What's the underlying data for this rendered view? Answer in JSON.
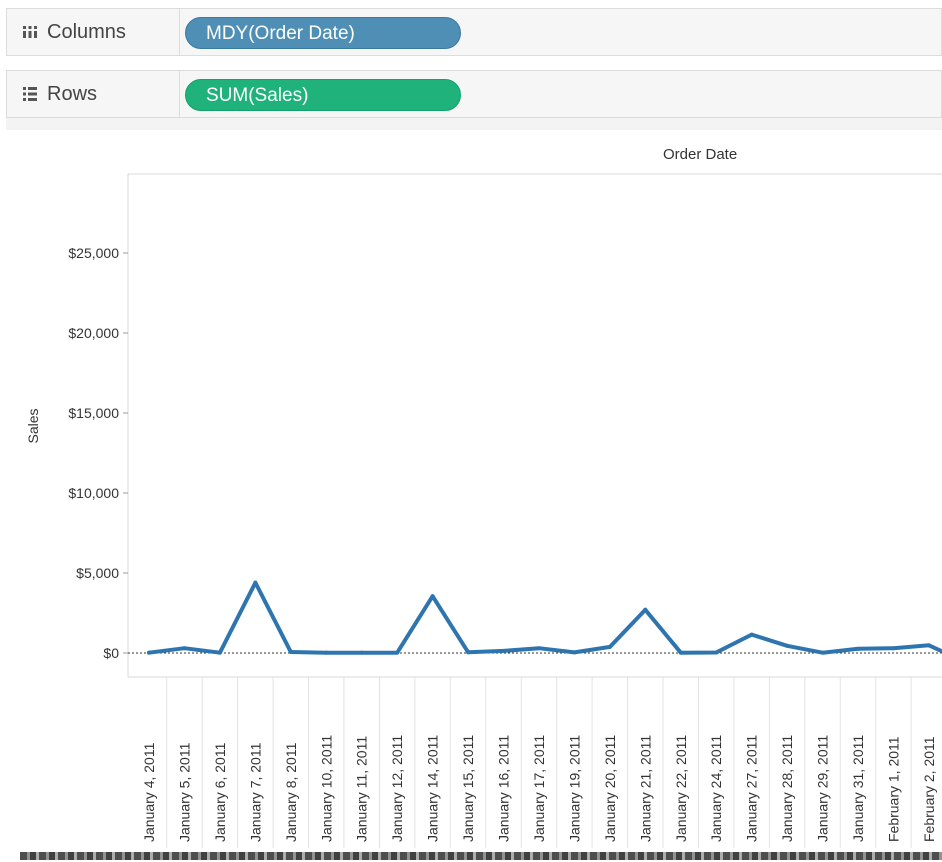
{
  "shelves": {
    "columns": {
      "label": "Columns",
      "icon": "columns-shelf-icon",
      "pill": "MDY(Order Date)",
      "pill_color": "#4f8fb6"
    },
    "rows": {
      "label": "Rows",
      "icon": "rows-shelf-icon",
      "pill": "SUM(Sales)",
      "pill_color": "#1fb37b"
    }
  },
  "chart_data": {
    "type": "line",
    "column_header": "Order Date",
    "ylabel": "Sales",
    "xlabel": "",
    "ylim": [
      -1500,
      29000
    ],
    "yticks": [
      0,
      5000,
      10000,
      15000,
      20000,
      25000
    ],
    "ytick_labels": [
      "$0",
      "$5,000",
      "$10,000",
      "$15,000",
      "$20,000",
      "$25,000"
    ],
    "grid": false,
    "zero_reference_line": true,
    "line_color": "#2e75b0",
    "categories": [
      "January 4, 2011",
      "January 5, 2011",
      "January 6, 2011",
      "January 7, 2011",
      "January 8, 2011",
      "January 10, 2011",
      "January 11, 2011",
      "January 12, 2011",
      "January 14, 2011",
      "January 15, 2011",
      "January 16, 2011",
      "January 17, 2011",
      "January 19, 2011",
      "January 20, 2011",
      "January 21, 2011",
      "January 22, 2011",
      "January 24, 2011",
      "January 27, 2011",
      "January 28, 2011",
      "January 29, 2011",
      "January 31, 2011",
      "February 1, 2011",
      "February 2, 2011"
    ],
    "values": [
      20,
      300,
      20,
      4400,
      60,
      20,
      20,
      20,
      3550,
      50,
      130,
      300,
      40,
      380,
      2700,
      20,
      30,
      1150,
      450,
      20,
      260,
      300,
      480
    ]
  }
}
